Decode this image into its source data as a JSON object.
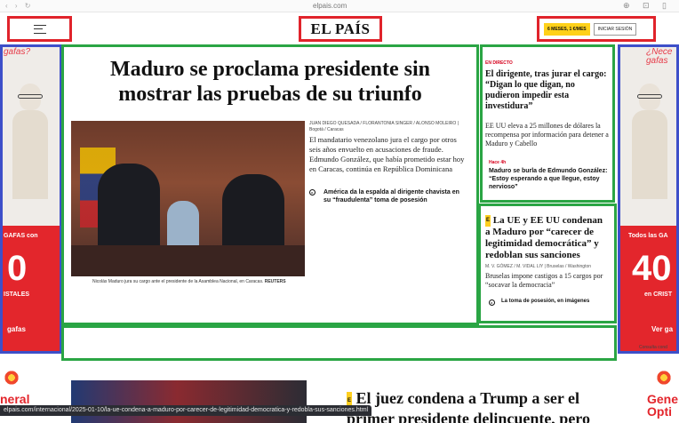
{
  "browser": {
    "url": "elpais.com",
    "nav_glyphs": "‹ › ↻",
    "tool_glyphs": "⊕ ⊡ ▯"
  },
  "header": {
    "menu_icon": "menu-icon",
    "logo": "EL PAÍS",
    "promo_label": "6 MESES, 1 €/MES",
    "login_label": "INICIAR SESIÓN"
  },
  "ads": {
    "left": {
      "tag": "gafas?",
      "line1": "GAFAS con",
      "big": "0",
      "line2": "ISTALES",
      "button": "gafas"
    },
    "right": {
      "tag": "¿Nece gafas",
      "line1": "Todos las GA",
      "big": "40",
      "line2": "en CRIST",
      "button": "Ver ga",
      "footer": "Consulta cond"
    },
    "bottom_left": "neral",
    "bottom_right": "Gene Opti"
  },
  "main_story": {
    "headline": "Maduro se proclama presidente sin mostrar las pruebas de su triunfo",
    "caption": "Nicolás Maduro jura su cargo ante el presidente de la Asamblea Nacional, en Caracas.",
    "credit": "REUTERS",
    "byline": "JUAN DIEGO QUESADA / FLORANTONIA SINGER / ALONSO MOLEIRO | Bogotá / Caracas",
    "summary": "El mandatario venezolano jura el cargo por otros seis años envuelto en acusaciones de fraude. Edmundo González, que había prometido estar hoy en Caracas, continúa en República Dominicana",
    "related_icon": "▸",
    "related": "América da la espalda al dirigente chavista en su “fraudulenta” toma de posesión"
  },
  "live_story": {
    "tag": "EN DIRECTO",
    "headline": "El dirigente, tras jurar el cargo: “Digan lo que digan, no pudieron impedir esta investidura”",
    "summary": "EE UU eleva a 25 millones de dólares la recompensa por información para detener a Maduro y Cabello",
    "time": "Hace 4h",
    "subheadline": "Maduro se burla de Edmundo González: “Estoy esperando a que llegue, estoy nervioso”"
  },
  "second_story": {
    "badge": "E",
    "headline": "La UE y EE UU condenan a Maduro por “carecer de legitimidad democrática” y redoblan sus sanciones",
    "byline": "M. V. GÓMEZ / M. VIDAL LIY | Bruselas / Washington",
    "summary": "Bruselas impone castigos a 15 cargos por “socavar la democracia”",
    "related": "La toma de posesión, en imágenes"
  },
  "bottom_story": {
    "badge": "E",
    "headline": "El juez condena a Trump a ser el primer presidente delincuente, pero"
  },
  "status_bar": {
    "url": "elpais.com/internacional/2025-01-10/la-ue-condena-a-maduro-por-carecer-de-legitimidad-democratica-y-redobla-sus-sanciones.html"
  },
  "colors": {
    "annotation_red": "#e0232b",
    "annotation_green": "#2aa544",
    "annotation_blue": "#3d4fc9",
    "promo_yellow": "#ffd11a",
    "live_red": "#d6001c"
  }
}
